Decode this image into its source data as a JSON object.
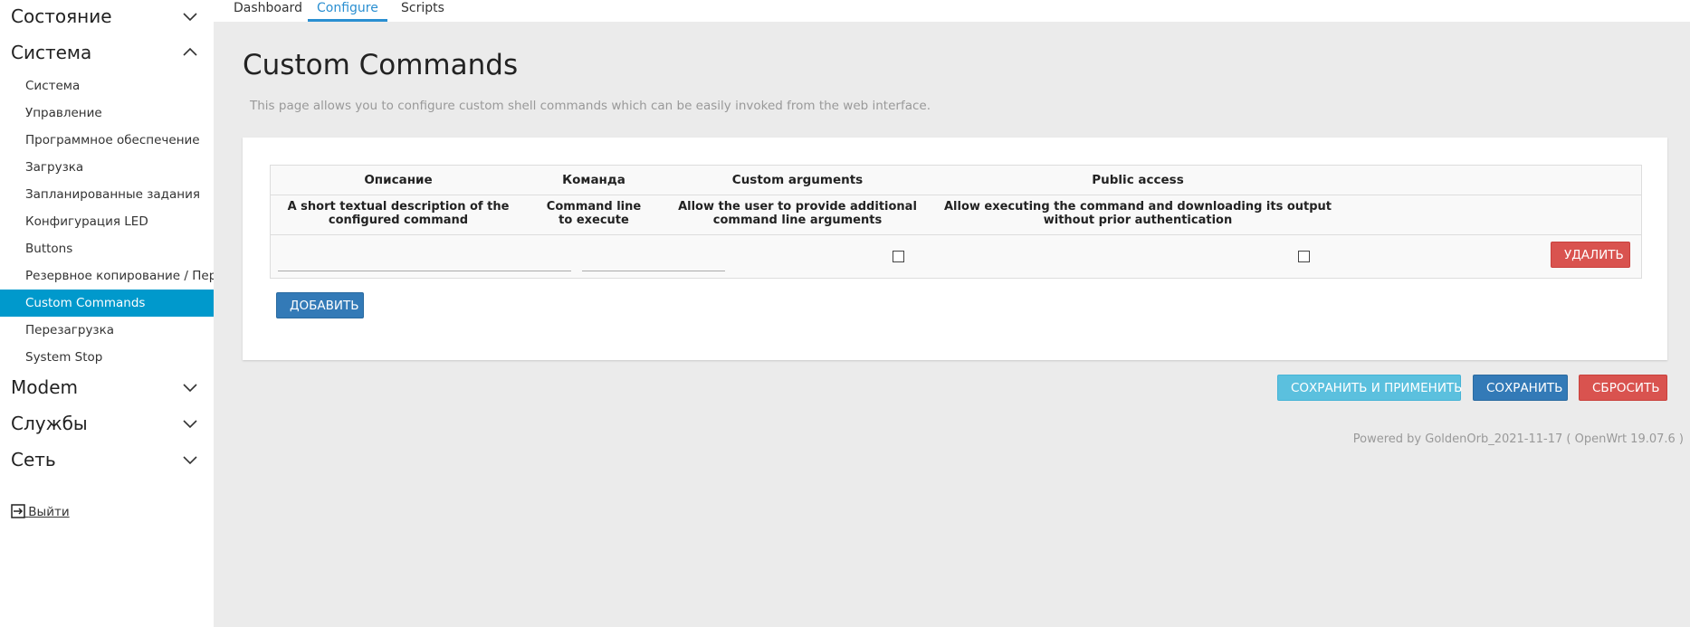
{
  "sidebar": {
    "sections": [
      {
        "label": "Состояние",
        "expanded": false
      },
      {
        "label": "Система",
        "expanded": true
      },
      {
        "label": "Modem",
        "expanded": false
      },
      {
        "label": "Службы",
        "expanded": false
      },
      {
        "label": "Сеть",
        "expanded": false
      }
    ],
    "system_items": [
      {
        "label": "Система",
        "active": false
      },
      {
        "label": "Управление",
        "active": false
      },
      {
        "label": "Программное обеспечение",
        "active": false
      },
      {
        "label": "Загрузка",
        "active": false
      },
      {
        "label": "Запланированные задания",
        "active": false
      },
      {
        "label": "Конфигурация LED",
        "active": false
      },
      {
        "label": "Buttons",
        "active": false
      },
      {
        "label": "Резервное копирование / Перепрошивка",
        "active": false
      },
      {
        "label": "Custom Commands",
        "active": true
      },
      {
        "label": "Перезагрузка",
        "active": false
      },
      {
        "label": "System Stop",
        "active": false
      }
    ],
    "logout_label": "Выйти"
  },
  "tabs": [
    {
      "label": "Dashboard",
      "active": false
    },
    {
      "label": "Configure",
      "active": true
    },
    {
      "label": "Scripts",
      "active": false
    }
  ],
  "page": {
    "title": "Custom Commands",
    "description": "This page allows you to configure custom shell commands which can be easily invoked from the web interface."
  },
  "table": {
    "columns": [
      {
        "title": "Описание",
        "description": "A short textual description of the configured command"
      },
      {
        "title": "Команда",
        "description": "Command line to execute"
      },
      {
        "title": "Custom arguments",
        "description": "Allow the user to provide additional command line arguments"
      },
      {
        "title": "Public access",
        "description": "Allow executing the command and downloading its output without prior authentication"
      }
    ],
    "row": {
      "description_value": "",
      "command_value": "",
      "custom_arguments_checked": false,
      "public_access_checked": false,
      "delete_label": "УДАЛИТЬ"
    },
    "add_label": "ДОБАВИТЬ"
  },
  "actions": {
    "save_apply_label": "СОХРАНИТЬ И ПРИМЕНИТЬ",
    "save_label": "СОХРАНИТЬ",
    "reset_label": "СБРОСИТЬ"
  },
  "footer": "Powered by GoldenOrb_2021-11-17 ( OpenWrt 19.07.6 )",
  "colors": {
    "accent": "#0099cc",
    "tab_active": "#2a8fd1",
    "primary": "#337ab7",
    "danger": "#d9534f",
    "info": "#5bc0de"
  }
}
